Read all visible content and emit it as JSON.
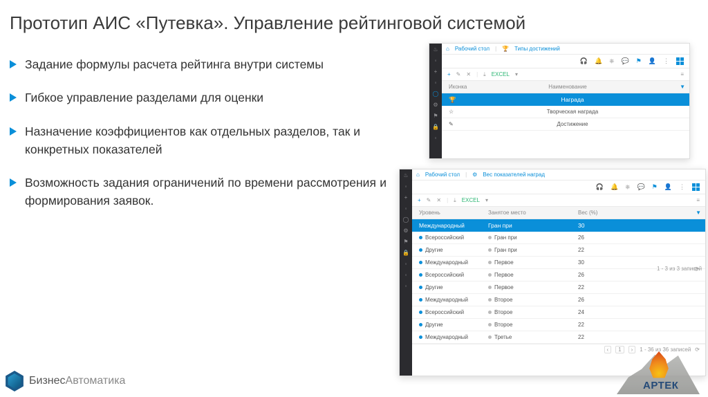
{
  "title": "Прототип АИС «Путевка». Управление рейтинговой системой",
  "bullets": [
    "Задание формулы расчета рейтинга внутри системы",
    "Гибкое управление разделами для оценки",
    "Назначение коэффициентов как отдельных разделов, так и конкретных показателей",
    "Возможность задания ограничений по времени рассмотрения и формирования заявок."
  ],
  "shot1": {
    "breadcrumb": {
      "home": "Рабочий стол",
      "page": "Типы достижений"
    },
    "toolbar_excel": "EXCEL",
    "headers": {
      "c1": "Иконка",
      "c2": "Наименование"
    },
    "highlight": "Награда",
    "rows": [
      "Творческая награда",
      "Достижение"
    ]
  },
  "shot2": {
    "breadcrumb": {
      "home": "Рабочий стол",
      "page": "Вес показателей наград"
    },
    "toolbar_excel": "EXCEL",
    "headers": {
      "c1": "Уровень",
      "c2": "Занятое место",
      "c3": "Вес (%)"
    },
    "highlight": {
      "c1": "Международный",
      "c2": "Гран при",
      "c3": "30"
    },
    "rows": [
      {
        "c1": "Всероссийский",
        "c2": "Гран при",
        "c3": "26"
      },
      {
        "c1": "Другие",
        "c2": "Гран при",
        "c3": "22"
      },
      {
        "c1": "Международный",
        "c2": "Первое",
        "c3": "30"
      },
      {
        "c1": "Всероссийский",
        "c2": "Первое",
        "c3": "26"
      },
      {
        "c1": "Другие",
        "c2": "Первое",
        "c3": "22"
      },
      {
        "c1": "Международный",
        "c2": "Второе",
        "c3": "26"
      },
      {
        "c1": "Всероссийский",
        "c2": "Второе",
        "c3": "24"
      },
      {
        "c1": "Другие",
        "c2": "Второе",
        "c3": "22"
      },
      {
        "c1": "Международный",
        "c2": "Третье",
        "c3": "22"
      }
    ],
    "footer": "1 - 36 из 36 записей",
    "side_count": "1 - 3 из 3 записей"
  },
  "footer": {
    "brand1": "Бизнес",
    "brand2": "Автоматика",
    "artek": "АРТЕК"
  }
}
